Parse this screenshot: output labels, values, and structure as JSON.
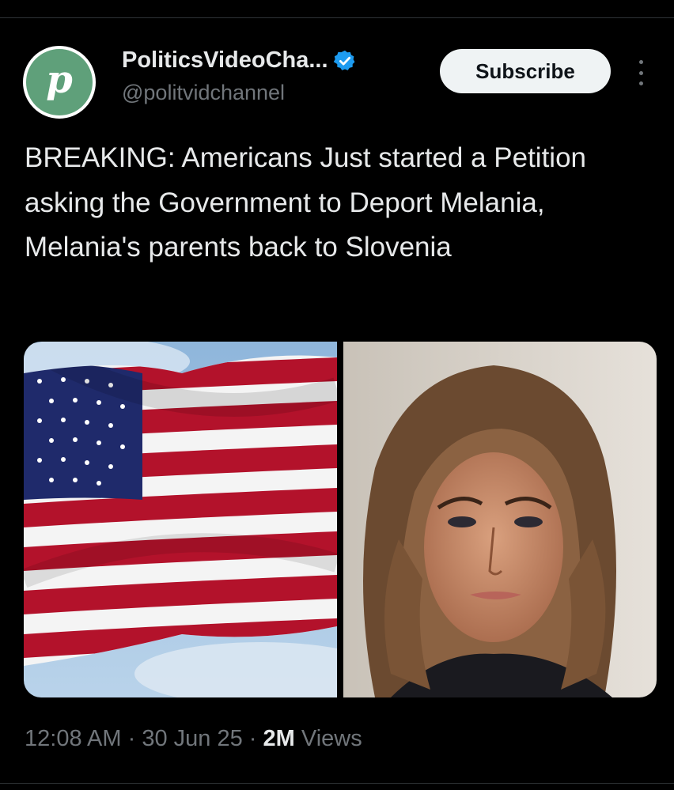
{
  "account": {
    "avatar_letter": "p",
    "display_name": "PoliticsVideoCha...",
    "handle": "@politvidchannel",
    "verified": true,
    "avatar_color": "#5fa07a"
  },
  "actions": {
    "subscribe_label": "Subscribe",
    "more_icon": "more-vertical-icon"
  },
  "tweet": {
    "text": "BREAKING: Americans Just started a Petition asking the Government to Deport Melania, Melania's parents back to Slovenia"
  },
  "media": {
    "images": [
      {
        "name": "american-flag-photo"
      },
      {
        "name": "woman-portrait-photo"
      }
    ]
  },
  "meta": {
    "time": "12:08 AM",
    "sep1": "·",
    "date": "30 Jun 25",
    "sep2": "·",
    "views_count": "2M",
    "views_label": "Views"
  },
  "colors": {
    "background": "#000000",
    "text": "#e7e9ea",
    "secondary": "#71767b",
    "verified": "#1d9bf0"
  }
}
